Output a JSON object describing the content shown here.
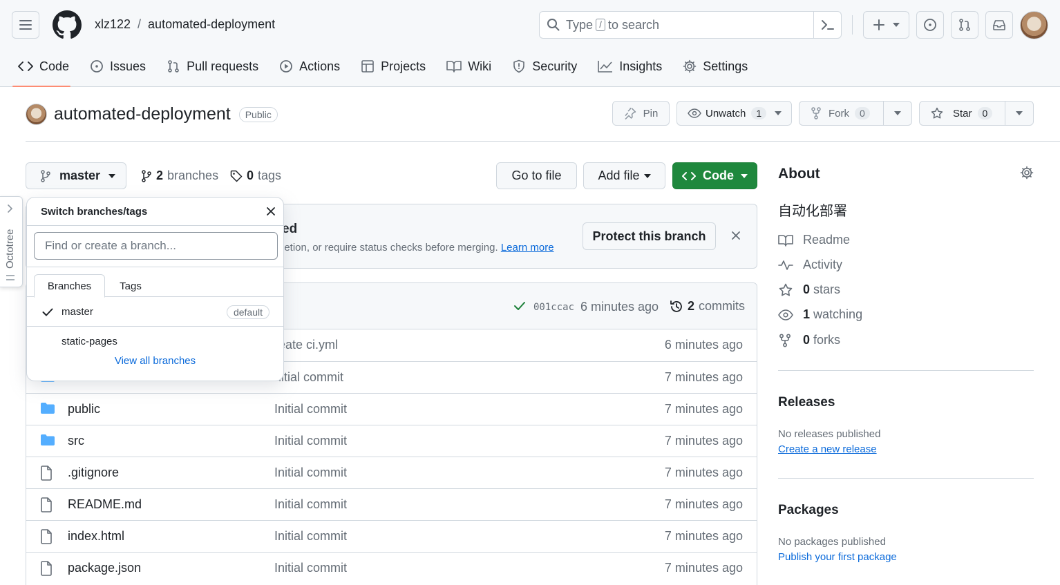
{
  "header": {
    "owner": "xlz122",
    "separator": "/",
    "repo": "automated-deployment",
    "search": {
      "prefix": "Type",
      "key": "/",
      "suffix": "to search"
    }
  },
  "tabs": [
    {
      "label": "Code",
      "icon": "code-icon"
    },
    {
      "label": "Issues",
      "icon": "issue-icon"
    },
    {
      "label": "Pull requests",
      "icon": "pull-request-icon"
    },
    {
      "label": "Actions",
      "icon": "play-icon"
    },
    {
      "label": "Projects",
      "icon": "table-icon"
    },
    {
      "label": "Wiki",
      "icon": "book-icon"
    },
    {
      "label": "Security",
      "icon": "shield-icon"
    },
    {
      "label": "Insights",
      "icon": "graph-icon"
    },
    {
      "label": "Settings",
      "icon": "gear-icon"
    }
  ],
  "repo_header": {
    "name": "automated-deployment",
    "visibility": "Public",
    "pin_label": "Pin",
    "unwatch_label": "Unwatch",
    "unwatch_count": "1",
    "fork_label": "Fork",
    "fork_count": "0",
    "star_label": "Star",
    "star_count": "0"
  },
  "branch_bar": {
    "branch": "master",
    "branches_count": "2",
    "branches_label": "branches",
    "tags_count": "0",
    "tags_label": "tags",
    "go_to_file": "Go to file",
    "add_file": "Add file",
    "code": "Code"
  },
  "banner": {
    "title_fragment": "ed",
    "text_fragment": "letion, or require status checks before merging.",
    "learn_more": "Learn more",
    "protect_button": "Protect this branch"
  },
  "commit_bar": {
    "sha": "001ccac",
    "time": "6 minutes ago",
    "commits_count": "2",
    "commits_label": "commits"
  },
  "files": [
    {
      "name": "",
      "type": "hidden",
      "msg": "reate ci.yml",
      "time": "6 minutes ago"
    },
    {
      "name": "",
      "type": "folder",
      "msg": "nitial commit",
      "time": "7 minutes ago"
    },
    {
      "name": "public",
      "type": "folder",
      "msg": "Initial commit",
      "time": "7 minutes ago"
    },
    {
      "name": "src",
      "type": "folder",
      "msg": "Initial commit",
      "time": "7 minutes ago"
    },
    {
      "name": ".gitignore",
      "type": "file",
      "msg": "Initial commit",
      "time": "7 minutes ago"
    },
    {
      "name": "README.md",
      "type": "file",
      "msg": "Initial commit",
      "time": "7 minutes ago"
    },
    {
      "name": "index.html",
      "type": "file",
      "msg": "Initial commit",
      "time": "7 minutes ago"
    },
    {
      "name": "package.json",
      "type": "file",
      "msg": "Initial commit",
      "time": "7 minutes ago"
    }
  ],
  "dropdown": {
    "title": "Switch branches/tags",
    "placeholder": "Find or create a branch...",
    "tab_branches": "Branches",
    "tab_tags": "Tags",
    "items": [
      {
        "name": "master",
        "badge": "default",
        "selected": true
      },
      {
        "name": "static-pages",
        "badge": "",
        "selected": false
      }
    ],
    "view_all": "View all branches"
  },
  "sidebar": {
    "about_title": "About",
    "description": "自动化部署",
    "readme": "Readme",
    "activity": "Activity",
    "stars_count": "0",
    "stars_label": "stars",
    "watching_count": "1",
    "watching_label": "watching",
    "forks_count": "0",
    "forks_label": "forks",
    "releases_title": "Releases",
    "releases_none": "No releases published",
    "releases_link": "Create a new release",
    "packages_title": "Packages",
    "packages_none": "No packages published",
    "packages_link": "Publish your first package"
  },
  "octotree": {
    "label": "Octotree"
  },
  "colors": {
    "accent_green": "#1f883d",
    "link": "#0969da",
    "tab_underline": "#fd8c73",
    "folder": "#54aeff"
  }
}
